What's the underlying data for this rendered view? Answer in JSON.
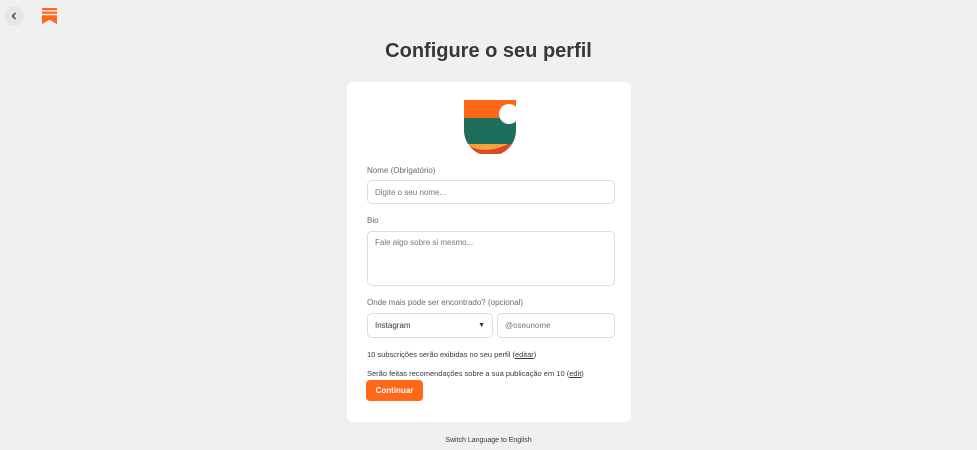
{
  "header": {
    "back_icon": "chevron-left-icon",
    "logo_icon": "substack-logo-icon",
    "brand_color": "#ff6719"
  },
  "page": {
    "title": "Configure o seu perfil"
  },
  "form": {
    "avatar_icon": "profile-avatar-icon",
    "name_label": "Nome (Obrigatório)",
    "name_placeholder": "Digite o seu nome...",
    "name_value": "",
    "bio_label": "Bio",
    "bio_placeholder": "Fale algo sobre si mesmo...",
    "bio_value": "",
    "social_label": "Onde mais pode ser encontrado? (opcional)",
    "social_platform": "Instagram",
    "social_placeholder": "@oseunome",
    "social_value": "",
    "subscriptions_text": "10 subscrições serão exibidas no seu perfil (",
    "subscriptions_link": "editar",
    "subscriptions_close": ")",
    "recommendations_text": "Serão feitas recomendações sobre a sua publicação em 10 (",
    "recommendations_link": "edit",
    "recommendations_close": ")",
    "continue_label": "Continuar"
  },
  "footer": {
    "switch_language": "Switch Language to English"
  }
}
